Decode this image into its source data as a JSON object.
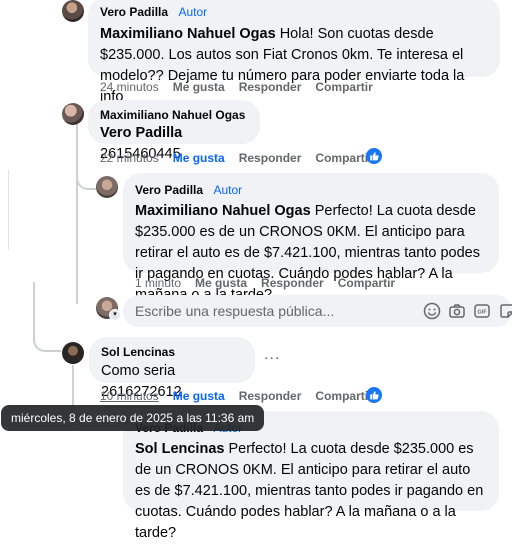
{
  "comments": [
    {
      "author": "Vero Padilla",
      "author_tag": "Autor",
      "mention": "Maximiliano Nahuel Ogas",
      "text": "Hola! Son cuotas desde $235.000. Los autos son Fiat Cronos 0km. Te interesa el modelo?? Dejame tu número para poder enviarte toda la info",
      "time": "24 minutos",
      "like_label": "Me gusta",
      "reply_label": "Responder",
      "share_label": "Compartir"
    },
    {
      "author": "Maximiliano Nahuel Ogas",
      "mention": "Vero Padilla",
      "text": "2615460445",
      "time": "22 minutos",
      "like_label": "Me gusta",
      "reply_label": "Responder",
      "share_label": "Compartir"
    },
    {
      "author": "Vero Padilla",
      "author_tag": "Autor",
      "mention": "Maximiliano Nahuel Ogas",
      "text": "Perfecto! La cuota desde $235.000 es de un CRONOS 0KM. El anticipo para retirar el auto es de $7.421.100, mientras tanto podes ir pagando en cuotas. Cuándo podes hablar? A la mañana o a la tarde?",
      "time": "1 minuto",
      "like_label": "Me gusta",
      "reply_label": "Responder",
      "share_label": "Compartir"
    },
    {
      "author": "Sol Lencinas",
      "text": "Como seria 2616272612",
      "time": "10 minutos",
      "like_label": "Me gusta",
      "reply_label": "Responder",
      "share_label": "Compartir"
    },
    {
      "author": "Vero Padilla",
      "author_tag": "Autor",
      "mention": "Sol Lencinas",
      "text": "Perfecto! La cuota desde $235.000 es de un CRONOS 0KM. El anticipo para retirar el auto es de $7.421.100, mientras tanto podes ir pagando en cuotas. Cuándo podes hablar? A la mañana o a la tarde?"
    }
  ],
  "reply_input": {
    "placeholder": "Escribe una respuesta pública..."
  },
  "tooltip": "miércoles, 8 de enero de 2025 a las 11:36 am",
  "more_options": "...",
  "colors": {
    "link_blue": "#0866ff",
    "like_badge": "#1877f2",
    "bubble_bg": "#f0f2f5",
    "meta_gray": "#65676b"
  }
}
